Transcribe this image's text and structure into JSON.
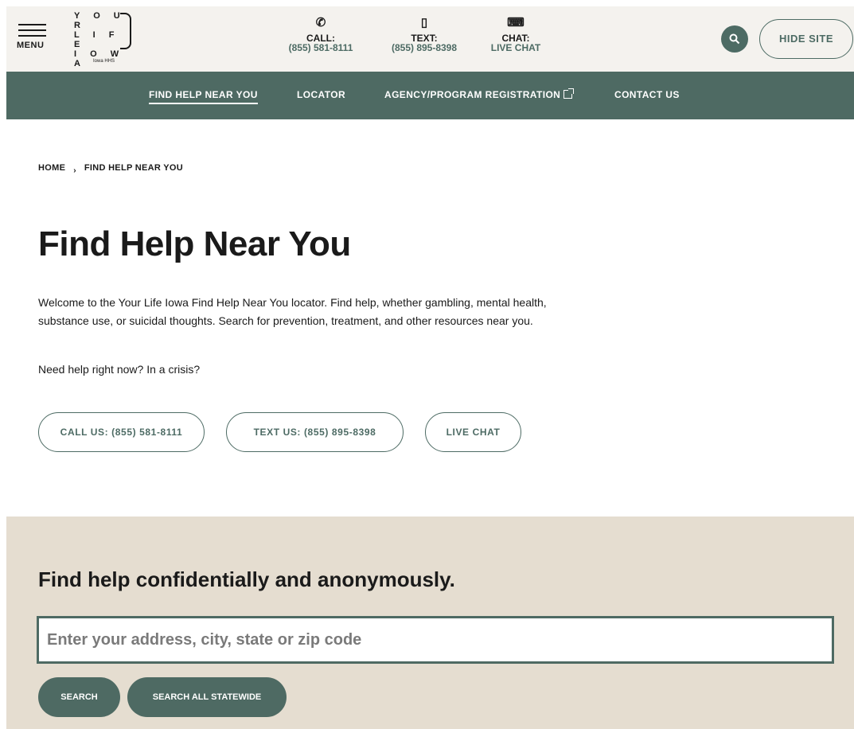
{
  "header": {
    "menu_label": "MENU",
    "logo_lines": [
      "Y O U R",
      "L I F E",
      "I O W A"
    ],
    "logo_sub": "Iowa HHS",
    "call": {
      "icon": "phone-icon",
      "label": "CALL:",
      "value": "(855) 581-8111"
    },
    "text": {
      "icon": "mobile-icon",
      "label": "TEXT:",
      "value": "(855) 895-8398"
    },
    "chat": {
      "icon": "keyboard-icon",
      "label": "CHAT:",
      "value": "LIVE CHAT"
    },
    "search_icon": "search-icon",
    "hide_site_label": "HIDE SITE"
  },
  "nav": {
    "items": [
      {
        "label": "FIND HELP NEAR YOU",
        "active": true
      },
      {
        "label": "LOCATOR"
      },
      {
        "label": "AGENCY/PROGRAM REGISTRATION",
        "external": true
      },
      {
        "label": "CONTACT US"
      }
    ]
  },
  "breadcrumb": {
    "home": "HOME",
    "current": "FIND HELP NEAR YOU"
  },
  "main": {
    "title": "Find Help Near You",
    "intro": "Welcome to the Your Life Iowa Find Help Near You locator.  Find help, whether gambling, mental health, substance use, or suicidal thoughts.  Search for prevention, treatment, and other resources near you.",
    "crisis_prompt": "Need help right now? In a crisis?",
    "call_button": "CALL US: (855) 581-8111",
    "text_button": "TEXT US: (855) 895-8398",
    "chat_button": "LIVE CHAT"
  },
  "search": {
    "heading": "Find help confidentially and anonymously.",
    "placeholder": "Enter your address, city, state or zip code",
    "search_button": "SEARCH",
    "statewide_button": "SEARCH ALL STATEWIDE"
  },
  "colors": {
    "brand_green": "#4e6a63",
    "header_bg": "#f4f2ee",
    "search_bg": "#e5ddd0"
  }
}
